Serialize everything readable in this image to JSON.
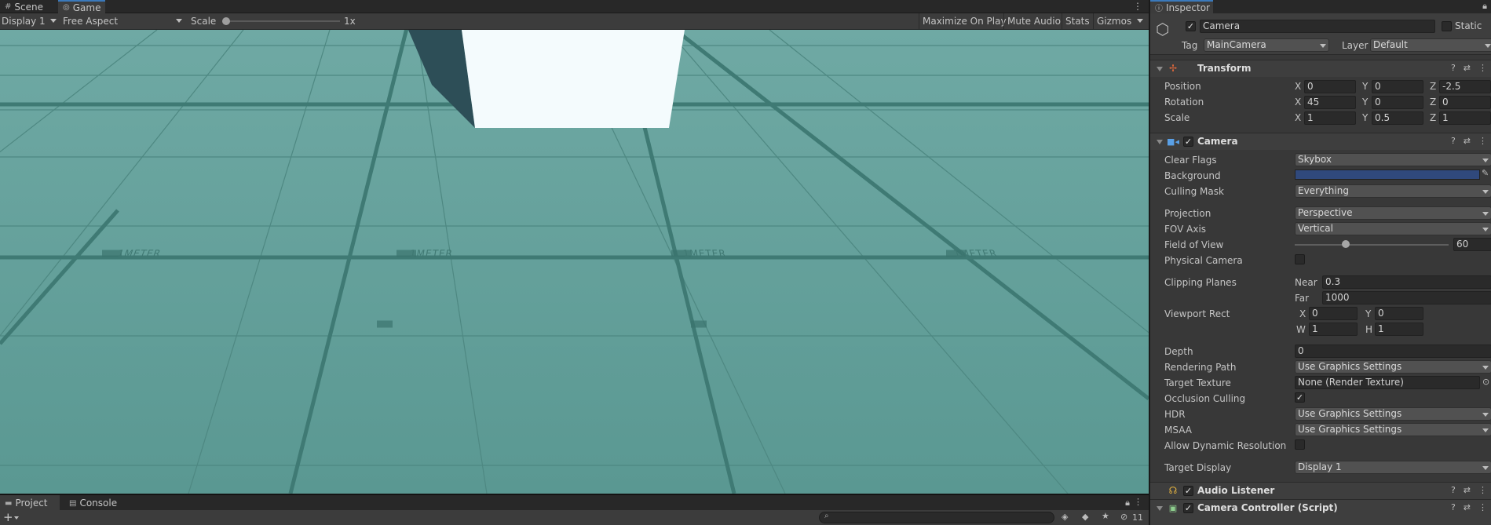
{
  "game_tabs": {
    "scene": "Scene",
    "game": "Game"
  },
  "game_toolbar": {
    "display": "Display 1",
    "aspect": "Free Aspect",
    "scale_label": "Scale",
    "scale_value": "1x",
    "scale_fraction": 0.0,
    "maximize": "Maximize On Play",
    "mute": "Mute Audio",
    "stats": "Stats",
    "gizmos": "Gizmos"
  },
  "viewport": {
    "floor_labels": [
      "1METER",
      "1METER",
      "1METER",
      "1METER"
    ],
    "colors": {
      "floor": "#5f9e98",
      "sky_line": "#6aa8a2",
      "cube": "#f4fbfd",
      "shadow": "#2d4e57"
    }
  },
  "bottom": {
    "project_tab": "Project",
    "console_tab": "Console",
    "search_placeholder": "",
    "hidden_count": "11"
  },
  "inspector": {
    "tab": "Inspector",
    "object": {
      "name": "Camera",
      "active": true,
      "static_label": "Static",
      "tag_label": "Tag",
      "tag": "MainCamera",
      "layer_label": "Layer",
      "layer": "Default"
    },
    "transform": {
      "title": "Transform",
      "position": {
        "label": "Position",
        "x": "0",
        "y": "0",
        "z": "-2.5"
      },
      "rotation": {
        "label": "Rotation",
        "x": "45",
        "y": "0",
        "z": "0"
      },
      "scale": {
        "label": "Scale",
        "x": "1",
        "y": "0.5",
        "z": "1"
      }
    },
    "camera": {
      "title": "Camera",
      "clear_flags": {
        "label": "Clear Flags",
        "value": "Skybox"
      },
      "background": {
        "label": "Background",
        "color": "#30497c"
      },
      "culling_mask": {
        "label": "Culling Mask",
        "value": "Everything"
      },
      "projection": {
        "label": "Projection",
        "value": "Perspective"
      },
      "fov_axis": {
        "label": "FOV Axis",
        "value": "Vertical"
      },
      "fov": {
        "label": "Field of View",
        "value": "60",
        "fraction": 0.33
      },
      "physical": {
        "label": "Physical Camera"
      },
      "clipping": {
        "label": "Clipping Planes",
        "near_label": "Near",
        "near": "0.3",
        "far_label": "Far",
        "far": "1000"
      },
      "viewport": {
        "label": "Viewport Rect",
        "x": "0",
        "y": "0",
        "w": "1",
        "h": "1"
      },
      "depth": {
        "label": "Depth",
        "value": "0"
      },
      "rendering_path": {
        "label": "Rendering Path",
        "value": "Use Graphics Settings"
      },
      "target_texture": {
        "label": "Target Texture",
        "value": "None (Render Texture)"
      },
      "occlusion": {
        "label": "Occlusion Culling",
        "checked": true
      },
      "hdr": {
        "label": "HDR",
        "value": "Use Graphics Settings"
      },
      "msaa": {
        "label": "MSAA",
        "value": "Use Graphics Settings"
      },
      "dynres": {
        "label": "Allow Dynamic Resolution"
      },
      "target_display": {
        "label": "Target Display",
        "value": "Display 1"
      }
    },
    "audio_listener": {
      "title": "Audio Listener"
    },
    "camera_controller": {
      "title": "Camera Controller (Script)"
    }
  }
}
